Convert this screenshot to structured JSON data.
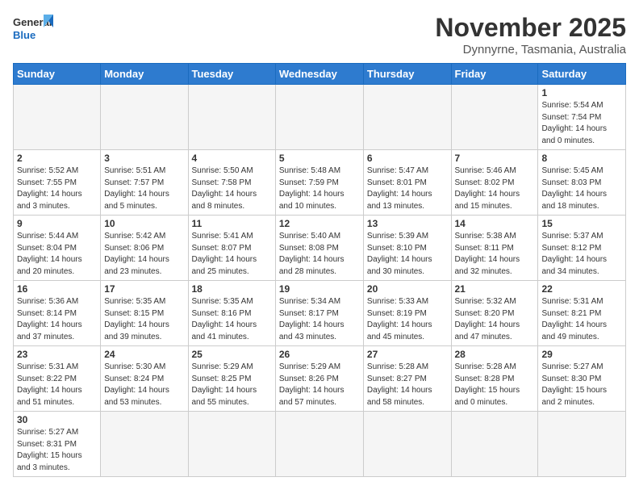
{
  "header": {
    "logo_general": "General",
    "logo_blue": "Blue",
    "month_title": "November 2025",
    "subtitle": "Dynnyrne, Tasmania, Australia"
  },
  "weekdays": [
    "Sunday",
    "Monday",
    "Tuesday",
    "Wednesday",
    "Thursday",
    "Friday",
    "Saturday"
  ],
  "weeks": [
    [
      {
        "day": null
      },
      {
        "day": null
      },
      {
        "day": null
      },
      {
        "day": null
      },
      {
        "day": null
      },
      {
        "day": null
      },
      {
        "day": 1,
        "info": "Sunrise: 5:54 AM\nSunset: 7:54 PM\nDaylight: 14 hours\nand 0 minutes."
      }
    ],
    [
      {
        "day": 2,
        "info": "Sunrise: 5:52 AM\nSunset: 7:55 PM\nDaylight: 14 hours\nand 3 minutes."
      },
      {
        "day": 3,
        "info": "Sunrise: 5:51 AM\nSunset: 7:57 PM\nDaylight: 14 hours\nand 5 minutes."
      },
      {
        "day": 4,
        "info": "Sunrise: 5:50 AM\nSunset: 7:58 PM\nDaylight: 14 hours\nand 8 minutes."
      },
      {
        "day": 5,
        "info": "Sunrise: 5:48 AM\nSunset: 7:59 PM\nDaylight: 14 hours\nand 10 minutes."
      },
      {
        "day": 6,
        "info": "Sunrise: 5:47 AM\nSunset: 8:01 PM\nDaylight: 14 hours\nand 13 minutes."
      },
      {
        "day": 7,
        "info": "Sunrise: 5:46 AM\nSunset: 8:02 PM\nDaylight: 14 hours\nand 15 minutes."
      },
      {
        "day": 8,
        "info": "Sunrise: 5:45 AM\nSunset: 8:03 PM\nDaylight: 14 hours\nand 18 minutes."
      }
    ],
    [
      {
        "day": 9,
        "info": "Sunrise: 5:44 AM\nSunset: 8:04 PM\nDaylight: 14 hours\nand 20 minutes."
      },
      {
        "day": 10,
        "info": "Sunrise: 5:42 AM\nSunset: 8:06 PM\nDaylight: 14 hours\nand 23 minutes."
      },
      {
        "day": 11,
        "info": "Sunrise: 5:41 AM\nSunset: 8:07 PM\nDaylight: 14 hours\nand 25 minutes."
      },
      {
        "day": 12,
        "info": "Sunrise: 5:40 AM\nSunset: 8:08 PM\nDaylight: 14 hours\nand 28 minutes."
      },
      {
        "day": 13,
        "info": "Sunrise: 5:39 AM\nSunset: 8:10 PM\nDaylight: 14 hours\nand 30 minutes."
      },
      {
        "day": 14,
        "info": "Sunrise: 5:38 AM\nSunset: 8:11 PM\nDaylight: 14 hours\nand 32 minutes."
      },
      {
        "day": 15,
        "info": "Sunrise: 5:37 AM\nSunset: 8:12 PM\nDaylight: 14 hours\nand 34 minutes."
      }
    ],
    [
      {
        "day": 16,
        "info": "Sunrise: 5:36 AM\nSunset: 8:14 PM\nDaylight: 14 hours\nand 37 minutes."
      },
      {
        "day": 17,
        "info": "Sunrise: 5:35 AM\nSunset: 8:15 PM\nDaylight: 14 hours\nand 39 minutes."
      },
      {
        "day": 18,
        "info": "Sunrise: 5:35 AM\nSunset: 8:16 PM\nDaylight: 14 hours\nand 41 minutes."
      },
      {
        "day": 19,
        "info": "Sunrise: 5:34 AM\nSunset: 8:17 PM\nDaylight: 14 hours\nand 43 minutes."
      },
      {
        "day": 20,
        "info": "Sunrise: 5:33 AM\nSunset: 8:19 PM\nDaylight: 14 hours\nand 45 minutes."
      },
      {
        "day": 21,
        "info": "Sunrise: 5:32 AM\nSunset: 8:20 PM\nDaylight: 14 hours\nand 47 minutes."
      },
      {
        "day": 22,
        "info": "Sunrise: 5:31 AM\nSunset: 8:21 PM\nDaylight: 14 hours\nand 49 minutes."
      }
    ],
    [
      {
        "day": 23,
        "info": "Sunrise: 5:31 AM\nSunset: 8:22 PM\nDaylight: 14 hours\nand 51 minutes."
      },
      {
        "day": 24,
        "info": "Sunrise: 5:30 AM\nSunset: 8:24 PM\nDaylight: 14 hours\nand 53 minutes."
      },
      {
        "day": 25,
        "info": "Sunrise: 5:29 AM\nSunset: 8:25 PM\nDaylight: 14 hours\nand 55 minutes."
      },
      {
        "day": 26,
        "info": "Sunrise: 5:29 AM\nSunset: 8:26 PM\nDaylight: 14 hours\nand 57 minutes."
      },
      {
        "day": 27,
        "info": "Sunrise: 5:28 AM\nSunset: 8:27 PM\nDaylight: 14 hours\nand 58 minutes."
      },
      {
        "day": 28,
        "info": "Sunrise: 5:28 AM\nSunset: 8:28 PM\nDaylight: 15 hours\nand 0 minutes."
      },
      {
        "day": 29,
        "info": "Sunrise: 5:27 AM\nSunset: 8:30 PM\nDaylight: 15 hours\nand 2 minutes."
      }
    ],
    [
      {
        "day": 30,
        "info": "Sunrise: 5:27 AM\nSunset: 8:31 PM\nDaylight: 15 hours\nand 3 minutes."
      },
      {
        "day": null,
        "last": true
      },
      {
        "day": null,
        "last": true
      },
      {
        "day": null,
        "last": true
      },
      {
        "day": null,
        "last": true
      },
      {
        "day": null,
        "last": true
      },
      {
        "day": null,
        "last": true
      }
    ]
  ]
}
